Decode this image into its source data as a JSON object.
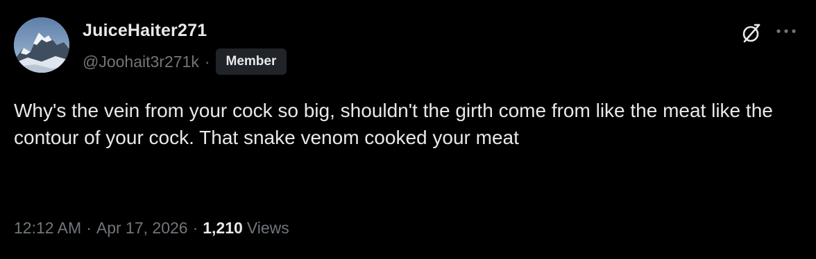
{
  "tweet": {
    "author": {
      "display_name": "JuiceHaiter271",
      "handle": "@Joohait3r271k",
      "separator": "·",
      "badge": "Member",
      "avatar_icon": "mountain-avatar-icon"
    },
    "actions": {
      "grok_icon": "grok-icon",
      "more_icon": "more-dots-icon"
    },
    "text": "Why's the vein from your cock so big, shouldn't the girth come from like the meat like the contour of your cock. That snake venom cooked your meat",
    "meta": {
      "time": "12:12 AM",
      "sep1": "·",
      "date": "Apr 17, 2026",
      "sep2": "·",
      "views_count": "1,210",
      "views_label": "Views"
    }
  },
  "colors": {
    "background": "#000000",
    "primary_text": "#e7e9ea",
    "secondary_text": "#71767b",
    "badge_bg": "#202327"
  }
}
